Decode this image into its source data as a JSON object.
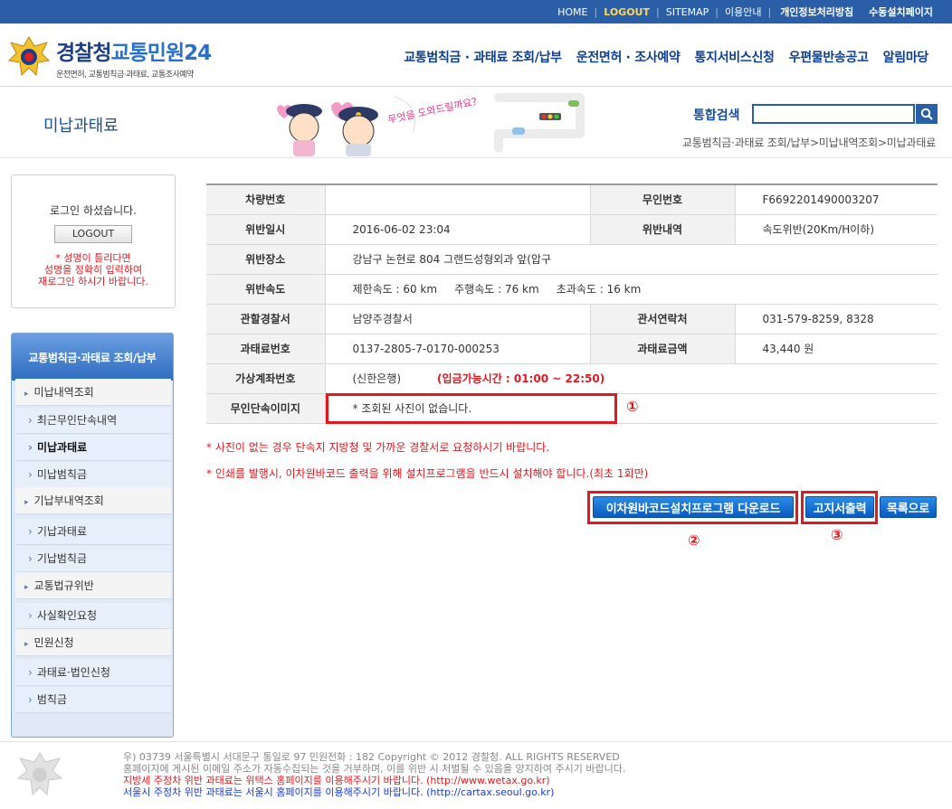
{
  "topbar": {
    "links": [
      "HOME",
      "LOGOUT",
      "SITEMAP",
      "이용안내",
      "개인정보처리방침",
      "수동설치페이지"
    ]
  },
  "logo": {
    "title_part1": "경찰청",
    "title_part2": "교통민원24",
    "subtitle": "운전면허, 교통범칙금·과태료, 교통조사예약"
  },
  "mainnav": [
    "교통범칙금 · 과태료 조회/납부",
    "운전면허 · 조사예약",
    "통지서비스신청",
    "우편물반송공고",
    "알림마당"
  ],
  "page": {
    "heading": "미납과태료",
    "illustration_text": "무엇을 도와드릴까요?",
    "breadcrumb": "교통범칙금·과태료 조회/납부>미납내역조회>미납과태료"
  },
  "search": {
    "label": "통합검색",
    "value": ""
  },
  "login": {
    "message": "로그인 하셨습니다.",
    "logout_label": "LOGOUT",
    "warning_1": "* 성명이 틀리다면",
    "warning_2": "성명을 정확히 입력하여",
    "warning_3": "재로그인 하시기 바랍니다."
  },
  "sidebar": {
    "title": "교통범칙금·과태료 조회/납부",
    "items": [
      {
        "label": "미납내역조회",
        "kind": "top"
      },
      {
        "label": "최근무인단속내역",
        "kind": "sub"
      },
      {
        "label": "미납과태료",
        "kind": "sub",
        "active": true
      },
      {
        "label": "미납범칙금",
        "kind": "sub"
      },
      {
        "label": "기납부내역조회",
        "kind": "top"
      },
      {
        "label": "기납과태료",
        "kind": "sub"
      },
      {
        "label": "기납범칙금",
        "kind": "sub"
      },
      {
        "label": "교통법규위반",
        "kind": "top"
      },
      {
        "label": "사실확인요청",
        "kind": "sub"
      },
      {
        "label": "민원신청",
        "kind": "top"
      },
      {
        "label": "과태료·법인신청",
        "kind": "sub"
      },
      {
        "label": "범칙금",
        "kind": "sub"
      }
    ]
  },
  "detail": {
    "vehicle_label": "차량번호",
    "vehicle_value": "",
    "unmanned_no_label": "무인번호",
    "unmanned_no_value": "F6692201490003207",
    "violation_date_label": "위반일시",
    "violation_date_value": "2016-06-02 23:04",
    "violation_type_label": "위반내역",
    "violation_type_value": "속도위반(20Km/H이하)",
    "place_label": "위반장소",
    "place_value": "강남구 논현로 804 그랜드성형외과 앞(압구",
    "speed_label": "위반속도",
    "speed_value": "제한속도 : 60 km     주행속도 : 76 km     초과속도 : 16 km",
    "station_label": "관할경찰서",
    "station_value": "남양주경찰서",
    "phone_label": "관서연락처",
    "phone_value": "031-579-8259, 8328",
    "fine_no_label": "과태료번호",
    "fine_no_value": "0137-2805-7-0170-000253",
    "amount_label": "과태료금액",
    "amount_value": "43,440 원",
    "account_label": "가상계좌번호",
    "account_value": "(신한은행)",
    "deposit_time": "(입금가능시간 : 01:00 ~ 22:50)",
    "image_label": "무인단속이미지",
    "image_value": "* 조회된 사진이 없습니다."
  },
  "markers": [
    "①",
    "②",
    "③"
  ],
  "notes": [
    "* 사진이 없는 경우 단속지 지방청 및 가까운 경찰서로 요청하시기 바랍니다.",
    "* 인쇄를 발행시, 이차원바코드 출력을 위해 설치프로그램을 반드시 설치해야 합니다.(최초 1회만)"
  ],
  "buttons": {
    "barcode_download": "이차원바코드설치프로그램 다운로드",
    "print_notice": "고지서출력",
    "back_to_list": "목록으로"
  },
  "footer": {
    "line1": "우) 03739 서울특별시 서대문구 통일로 97 민원전화 : 182      Copyright © 2012 경찰청. ALL RIGHTS RESERVED",
    "line2": "홈페이지에 게시된 이메일 주소가 자동수집되는 것을 거부하며, 이를 위반 시 처벌될 수 있음을 양지하여 주시기 바랍니다.",
    "line3": "지방세 주정차 위반 과태료는 위택스 홈페이지를 이용해주시기 바랍니다. (http://www.wetax.go.kr)",
    "line4": "서울시 주정차 위반 과태료는 서울시 홈페이지를 이용해주시기 바랍니다. (http://cartax.seoul.go.kr)"
  },
  "colors": {
    "brand_blue": "#2a5ea7",
    "alert_red": "#e0181f",
    "button_blue": "#0a5bbf"
  }
}
